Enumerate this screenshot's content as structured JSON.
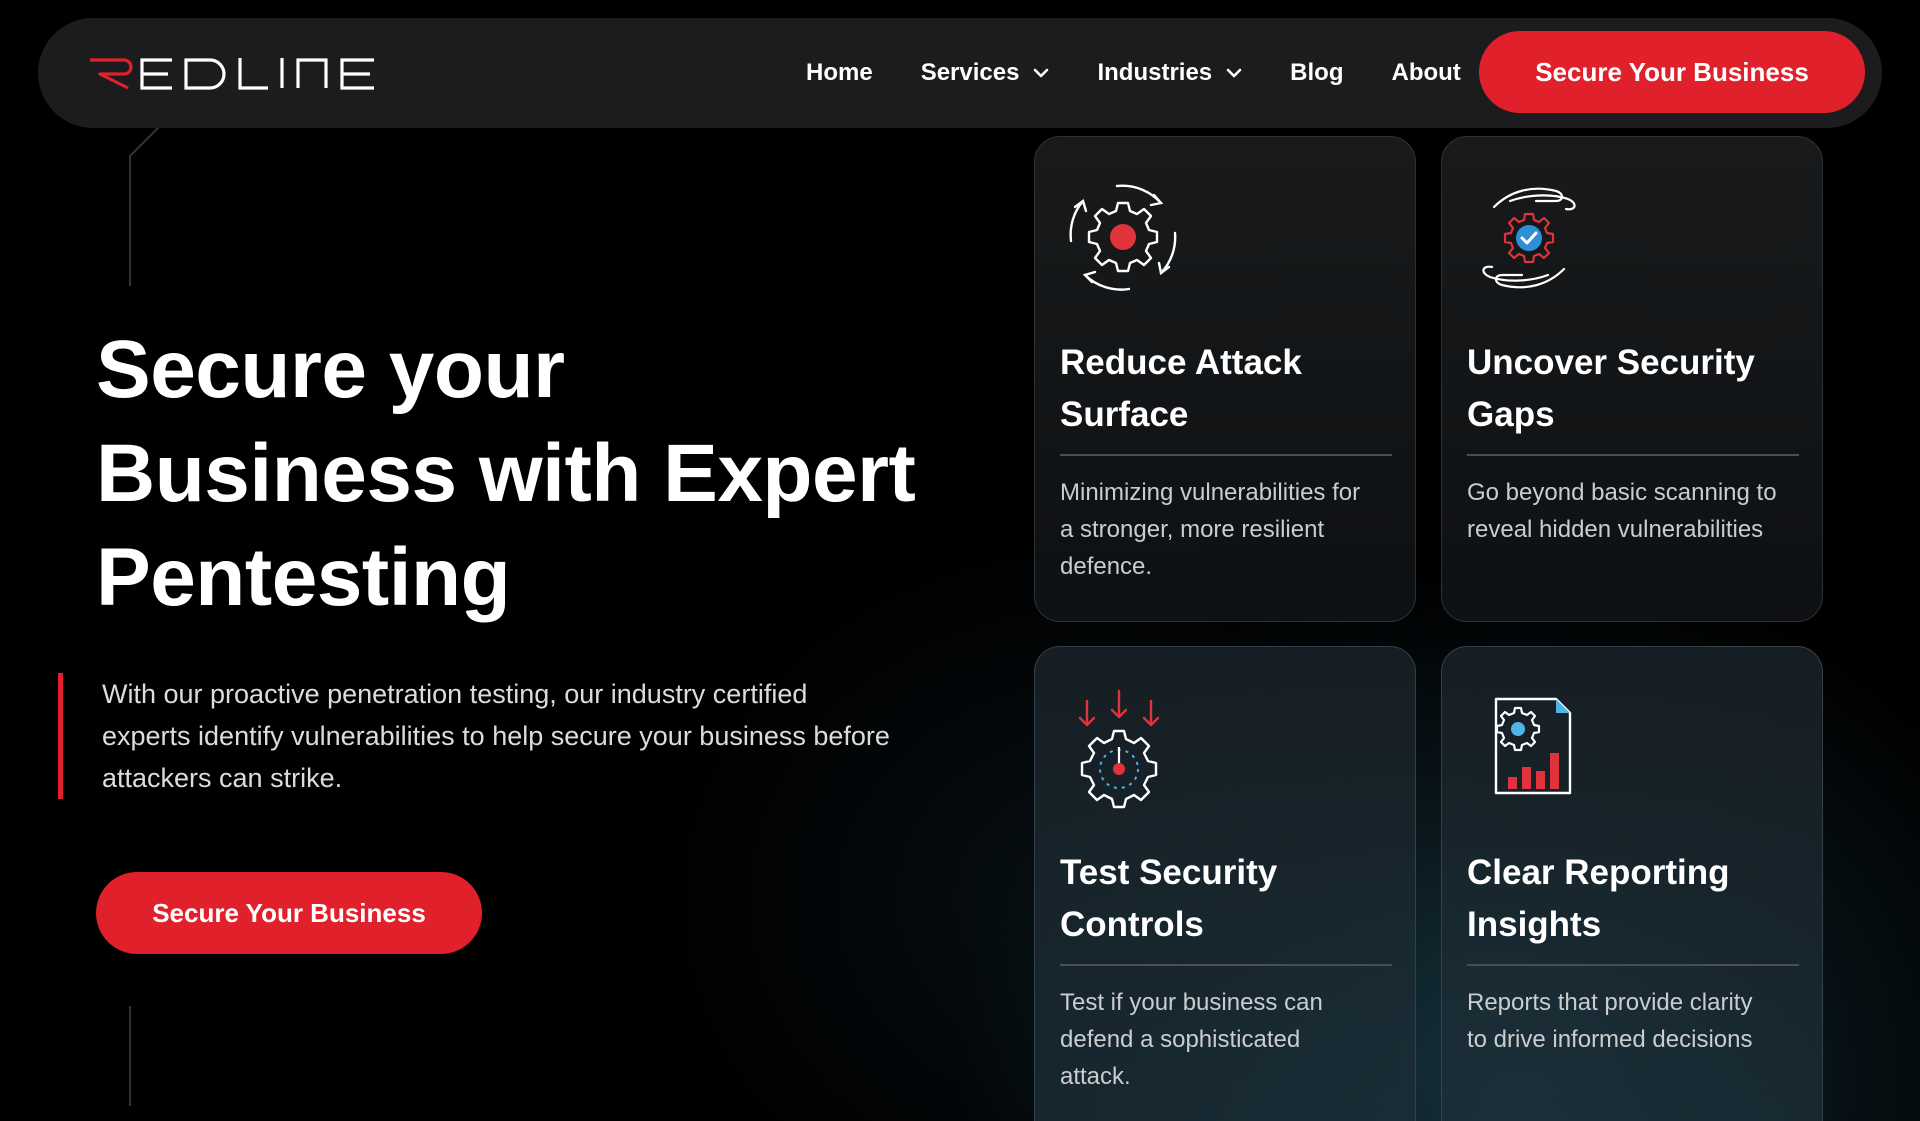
{
  "brand": {
    "name": "REDLINE",
    "accent_color": "#e0202a"
  },
  "nav": {
    "items": [
      {
        "label": "Home",
        "has_dropdown": false
      },
      {
        "label": "Services",
        "has_dropdown": true
      },
      {
        "label": "Industries",
        "has_dropdown": true
      },
      {
        "label": "Blog",
        "has_dropdown": false
      },
      {
        "label": "About",
        "has_dropdown": false
      }
    ],
    "cta_label": "Secure Your Business"
  },
  "hero": {
    "title_lines": [
      "Secure your",
      "Business with Expert",
      "Pentesting"
    ],
    "description_lines": [
      "With our proactive penetration testing, our industry certified",
      "experts identify vulnerabilities to help secure your business before",
      "attackers can strike."
    ],
    "cta_label": "Secure Your Business"
  },
  "cards": [
    {
      "icon": "gear-cycle-icon",
      "title_lines": [
        "Reduce Attack",
        "Surface"
      ],
      "description_lines": [
        "Minimizing vulnerabilities for",
        "a stronger, more resilient",
        "defence."
      ]
    },
    {
      "icon": "hands-shield-gear-icon",
      "title_lines": [
        "Uncover Security",
        "Gaps"
      ],
      "description_lines": [
        "Go beyond basic scanning to",
        "reveal hidden vulnerabilities"
      ]
    },
    {
      "icon": "gear-arrows-target-icon",
      "title_lines": [
        "Test Security",
        "Controls"
      ],
      "description_lines": [
        "Test if your business can",
        "defend a sophisticated",
        "attack."
      ]
    },
    {
      "icon": "report-chart-icon",
      "title_lines": [
        "Clear Reporting",
        "Insights"
      ],
      "description_lines": [
        "Reports that provide clarity",
        "to drive informed decisions"
      ]
    }
  ]
}
